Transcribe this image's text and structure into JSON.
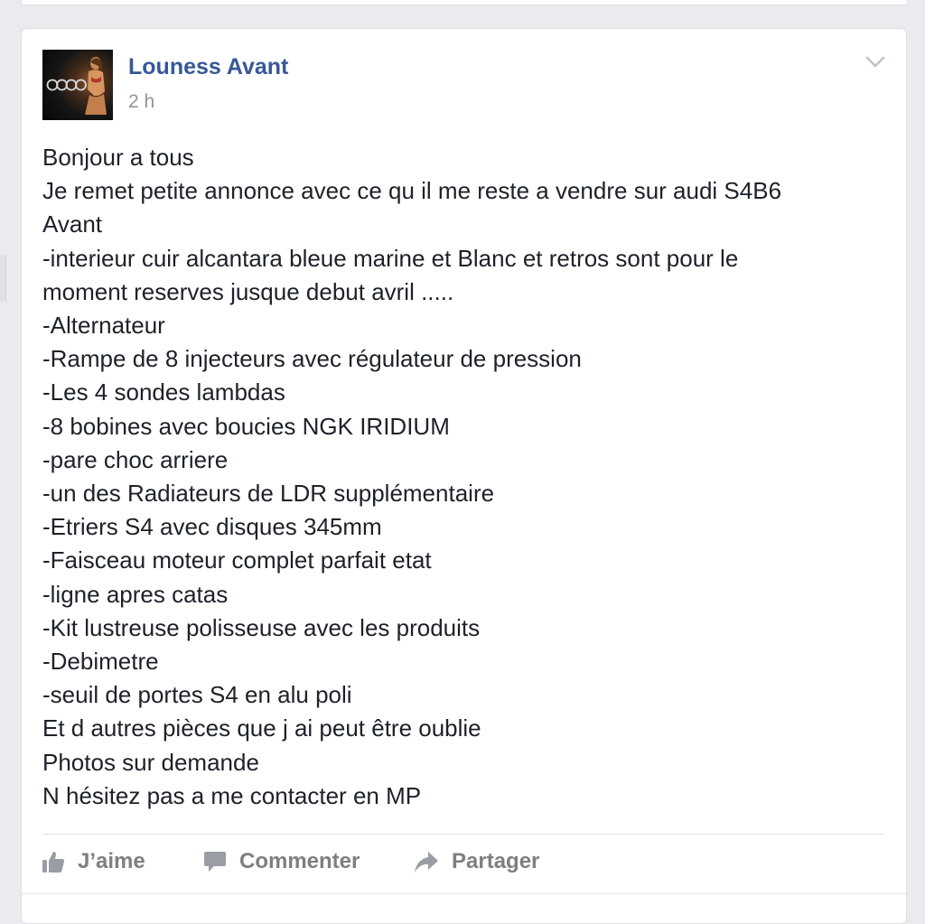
{
  "post": {
    "author": "Louness Avant",
    "timestamp": "2 h",
    "body_lines": [
      "Bonjour a tous",
      "Je remet petite annonce avec ce qu il me reste a vendre sur audi S4B6",
      "Avant",
      "-interieur cuir alcantara bleue marine et Blanc et retros sont pour le",
      "moment reserves jusque debut avril .....",
      "-Alternateur",
      "-Rampe de 8 injecteurs avec régulateur de pression",
      "-Les 4 sondes lambdas",
      "-8 bobines avec boucies NGK IRIDIUM",
      "-pare choc arriere",
      "-un des Radiateurs de LDR supplémentaire",
      "-Etriers S4 avec disques 345mm",
      "-Faisceau moteur complet parfait etat",
      "-ligne apres catas",
      "-Kit lustreuse polisseuse avec les produits",
      "-Debimetre",
      "-seuil de portes S4 en alu poli",
      "Et d autres pièces que j ai peut être oublie",
      "Photos sur demande",
      "N hésitez pas a me contacter en MP"
    ]
  },
  "actions": {
    "like_label": "J’aime",
    "comment_label": "Commenter",
    "share_label": "Partager"
  },
  "icons": {
    "menu": "chevron-down-icon",
    "like": "thumbs-up-icon",
    "comment": "speech-bubble-icon",
    "share": "share-arrow-icon"
  },
  "colors": {
    "author_link": "#365899",
    "text": "#1d2129",
    "meta": "#90949c",
    "action": "#7f7f7f",
    "background": "#e9ebee"
  }
}
